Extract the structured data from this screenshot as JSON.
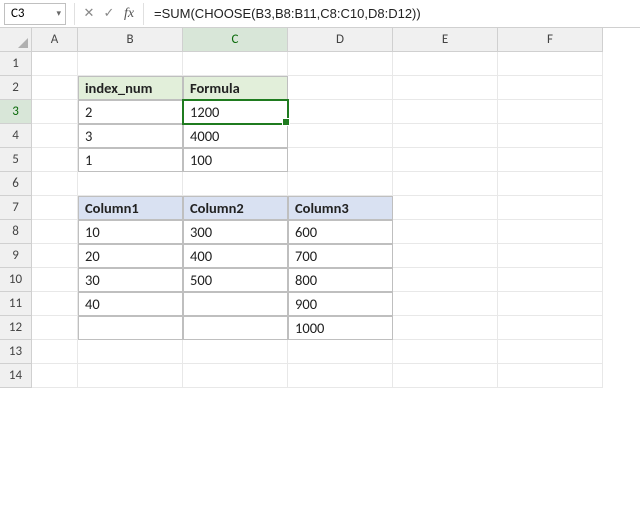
{
  "nameBox": {
    "value": "C3"
  },
  "formulaBar": {
    "cancelGlyph": "✕",
    "confirmGlyph": "✓",
    "fxGlyph": "fx",
    "formula": "=SUM(CHOOSE(B3,B8:B11,C8:C10,D8:D12))"
  },
  "columns": [
    "A",
    "B",
    "C",
    "D",
    "E",
    "F"
  ],
  "rows": [
    "1",
    "2",
    "3",
    "4",
    "5",
    "6",
    "7",
    "8",
    "9",
    "10",
    "11",
    "12",
    "13",
    "14"
  ],
  "activeColumn": "C",
  "activeRow": "3",
  "table1": {
    "headers": {
      "B2": "index_num",
      "C2": "Formula"
    },
    "data": {
      "B3": "2",
      "C3": "1200",
      "B4": "3",
      "C4": "4000",
      "B5": "1",
      "C5": "100"
    }
  },
  "table2": {
    "headers": {
      "B7": "Column1",
      "C7": "Column2",
      "D7": "Column3"
    },
    "data": {
      "B8": "10",
      "C8": "300",
      "D8": "600",
      "B9": "20",
      "C9": "400",
      "D9": "700",
      "B10": "30",
      "C10": "500",
      "D10": "800",
      "B11": "40",
      "C11": "",
      "D11": "900",
      "B12": "",
      "C12": "",
      "D12": "1000"
    }
  },
  "chart_data": [
    {
      "type": "table",
      "title": "index_num / Formula",
      "columns": [
        "index_num",
        "Formula"
      ],
      "rows": [
        [
          2,
          1200
        ],
        [
          3,
          4000
        ],
        [
          1,
          100
        ]
      ]
    },
    {
      "type": "table",
      "title": "Columns",
      "columns": [
        "Column1",
        "Column2",
        "Column3"
      ],
      "rows": [
        [
          10,
          300,
          600
        ],
        [
          20,
          400,
          700
        ],
        [
          30,
          500,
          800
        ],
        [
          40,
          null,
          900
        ],
        [
          null,
          null,
          1000
        ]
      ]
    }
  ]
}
